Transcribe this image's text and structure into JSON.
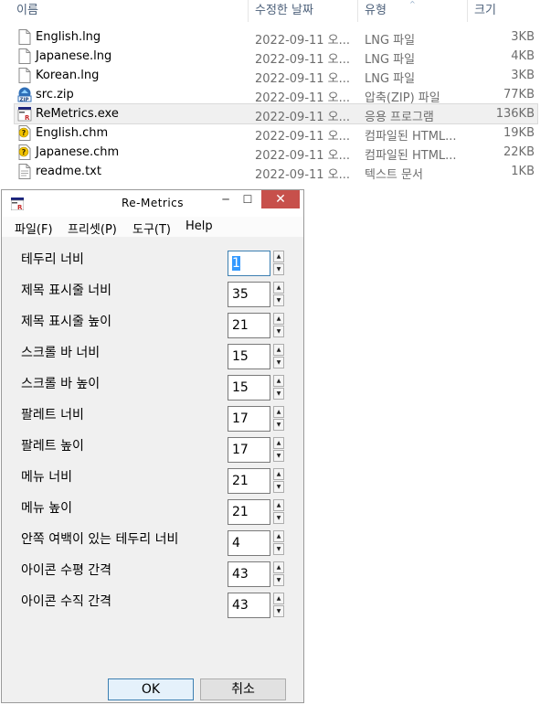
{
  "explorer": {
    "columns": {
      "name": "이름",
      "date": "수정한 날짜",
      "type": "유형",
      "size": "크기"
    },
    "sort_indicator": "^",
    "files": [
      {
        "name": "English.lng",
        "date": "2022-09-11 오...",
        "type": "LNG 파일",
        "size": "3KB",
        "icon": "document-icon"
      },
      {
        "name": "Japanese.lng",
        "date": "2022-09-11 오...",
        "type": "LNG 파일",
        "size": "4KB",
        "icon": "document-icon"
      },
      {
        "name": "Korean.lng",
        "date": "2022-09-11 오...",
        "type": "LNG 파일",
        "size": "3KB",
        "icon": "document-icon"
      },
      {
        "name": "src.zip",
        "date": "2022-09-11 오...",
        "type": "압축(ZIP) 파일",
        "size": "77KB",
        "icon": "zip-icon"
      },
      {
        "name": "ReMetrics.exe",
        "date": "2022-09-11 오...",
        "type": "응용 프로그램",
        "size": "136KB",
        "icon": "app-icon"
      },
      {
        "name": "English.chm",
        "date": "2022-09-11 오...",
        "type": "컴파일된 HTML...",
        "size": "19KB",
        "icon": "help-file-icon"
      },
      {
        "name": "Japanese.chm",
        "date": "2022-09-11 오...",
        "type": "컴파일된 HTML...",
        "size": "22KB",
        "icon": "help-file-icon"
      },
      {
        "name": "readme.txt",
        "date": "2022-09-11 오...",
        "type": "텍스트 문서",
        "size": "1KB",
        "icon": "text-file-icon"
      }
    ],
    "selected_index": 4
  },
  "dialog": {
    "title": "Re-Metrics",
    "controls": {
      "minimize": "─",
      "maximize": "☐",
      "close": "✕"
    },
    "menu": [
      "파일(F)",
      "프리셋(P)",
      "도구(T)",
      "Help"
    ],
    "fields": [
      {
        "label": "테두리 너비",
        "value": "1"
      },
      {
        "label": "제목 표시줄 너비",
        "value": "35"
      },
      {
        "label": "제목 표시줄 높이",
        "value": "21"
      },
      {
        "label": "스크롤 바 너비",
        "value": "15"
      },
      {
        "label": "스크롤 바 높이",
        "value": "15"
      },
      {
        "label": "팔레트 너비",
        "value": "17"
      },
      {
        "label": "팔레트 높이",
        "value": "17"
      },
      {
        "label": "메뉴 너비",
        "value": "21"
      },
      {
        "label": "메뉴 높이",
        "value": "21"
      },
      {
        "label": "안쪽 여백이 있는 테두리 너비",
        "value": "4"
      },
      {
        "label": "아이콘 수평 간격",
        "value": "43"
      },
      {
        "label": "아이콘 수직 간격",
        "value": "43"
      }
    ],
    "focused_field": 0,
    "spin_up": "▲",
    "spin_down": "▼",
    "ok_label": "OK",
    "cancel_label": "취소"
  }
}
